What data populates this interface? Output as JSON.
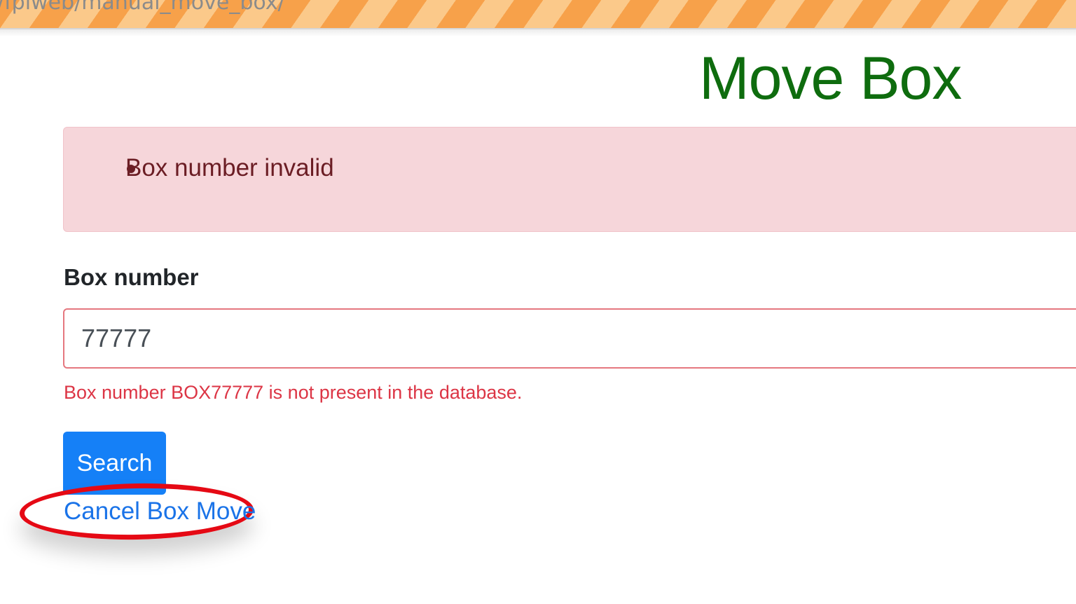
{
  "browser": {
    "url_fragment": "/fpiweb/manual_move_box/"
  },
  "page": {
    "title": "Move Box"
  },
  "alert": {
    "errors": [
      "Box number invalid"
    ]
  },
  "form": {
    "box_number_label": "Box number",
    "box_number_value": "77777",
    "box_number_error": "Box number BOX77777 is not present in the database.",
    "search_label": "Search",
    "cancel_label": "Cancel Box Move"
  },
  "colors": {
    "title": "#0e6c0e",
    "alert_bg": "#f6d6da",
    "alert_text": "#6b1d24",
    "error_text": "#dc3545",
    "primary_button": "#1580f7",
    "link": "#1a73e8",
    "annotation": "#e50914"
  }
}
